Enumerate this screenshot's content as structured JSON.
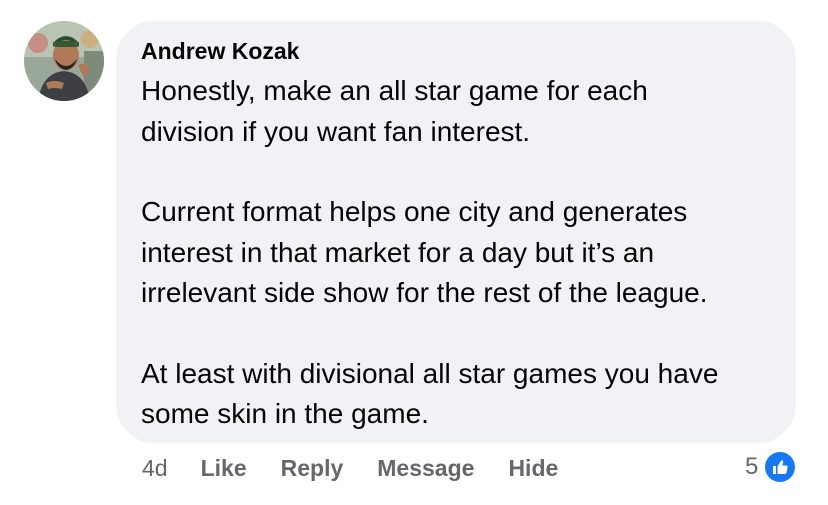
{
  "comment": {
    "author": "Andrew Kozak",
    "avatar_icon": "user-profile-photo",
    "paragraphs": [
      [
        "Honestly, make an all star game for each",
        "division if you want fan interest."
      ],
      [
        "Current format helps one city and generates",
        "interest in that market for a day but it’s an",
        "irrelevant side show for the rest of the league."
      ],
      [
        "At least with divisional all star games you have",
        "some skin in the game."
      ]
    ]
  },
  "actions": {
    "timestamp": "4d",
    "like_label": "Like",
    "reply_label": "Reply",
    "message_label": "Message",
    "hide_label": "Hide"
  },
  "reactions": {
    "count": "5",
    "icon": "thumbs-up-icon",
    "color": "#1877f2"
  },
  "colors": {
    "bubble": "#f0f2f5",
    "text": "#050505",
    "secondary_text": "#65676b"
  }
}
